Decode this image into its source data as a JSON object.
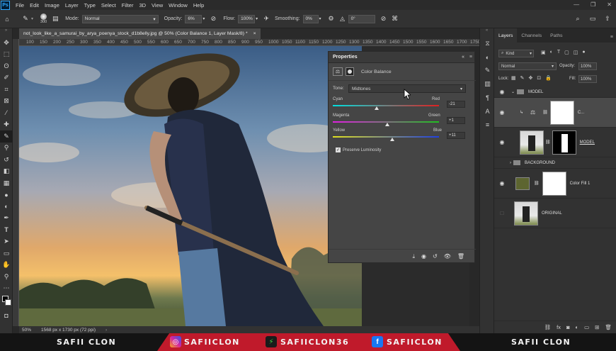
{
  "app": {
    "logo": "Ps"
  },
  "menu": [
    "File",
    "Edit",
    "Image",
    "Layer",
    "Type",
    "Select",
    "Filter",
    "3D",
    "View",
    "Window",
    "Help"
  ],
  "options": {
    "brush_size": "300",
    "mode_label": "Mode:",
    "mode_value": "Normal",
    "opacity_label": "Opacity:",
    "opacity_value": "6%",
    "flow_label": "Flow:",
    "flow_value": "100%",
    "smoothing_label": "Smoothing:",
    "smoothing_value": "0%",
    "angle_value": "0°"
  },
  "document": {
    "tab_title": "not_look_like_a_samurai_by_arya_poenya_stock_d1b8elly.jpg @ 50% (Color Balance 1, Layer Mask/8) *",
    "close": "×"
  },
  "ruler_ticks": [
    "100",
    "150",
    "200",
    "250",
    "300",
    "350",
    "400",
    "450",
    "500",
    "550",
    "600",
    "650",
    "700",
    "750",
    "800",
    "850",
    "900",
    "950",
    "1000",
    "1050",
    "1100",
    "1150",
    "1200",
    "1250",
    "1300",
    "1350",
    "1400",
    "1450",
    "1500",
    "1550",
    "1600",
    "1650",
    "1700",
    "1750"
  ],
  "status": {
    "zoom": "50%",
    "doc_info": "1568 px x 1730 px (72 ppi)"
  },
  "properties": {
    "title": "Properties",
    "panel_label": "Color Balance",
    "tone_label": "Tone:",
    "tone_value": "Midtones",
    "sliders": [
      {
        "left": "Cyan",
        "right": "Red",
        "value": "-21",
        "pos": 0.41
      },
      {
        "left": "Magenta",
        "right": "Green",
        "value": "+1",
        "pos": 0.51
      },
      {
        "left": "Yellow",
        "right": "Blue",
        "value": "+11",
        "pos": 0.56
      }
    ],
    "preserve_label": "Preserve Luminosity",
    "preserve_checked": true
  },
  "layers": {
    "tabs": [
      "Layers",
      "Channels",
      "Paths"
    ],
    "kind_label": "Kind",
    "blend_mode": "Normal",
    "opacity_label": "Opacity:",
    "opacity_value": "100%",
    "lock_label": "Lock:",
    "fill_label": "Fill:",
    "fill_value": "100%",
    "rows": [
      {
        "name": "MODEL",
        "type": "group"
      },
      {
        "name": "C...",
        "type": "adjustment"
      },
      {
        "name": "MODEL",
        "type": "masked"
      },
      {
        "name": "BACKGROUND",
        "type": "group"
      },
      {
        "name": "Color Fill 1",
        "type": "fill"
      },
      {
        "name": "ORIGINAL",
        "type": "image"
      }
    ]
  },
  "banner": {
    "left": "SAFII CLON",
    "instagram": "SAFIICLON",
    "website": "SAFIICLON36",
    "facebook": "SAFIICLON",
    "right": "SAFII CLON"
  },
  "colors": {
    "accent": "#31a8ff",
    "banner_red": "#c01a2b"
  }
}
